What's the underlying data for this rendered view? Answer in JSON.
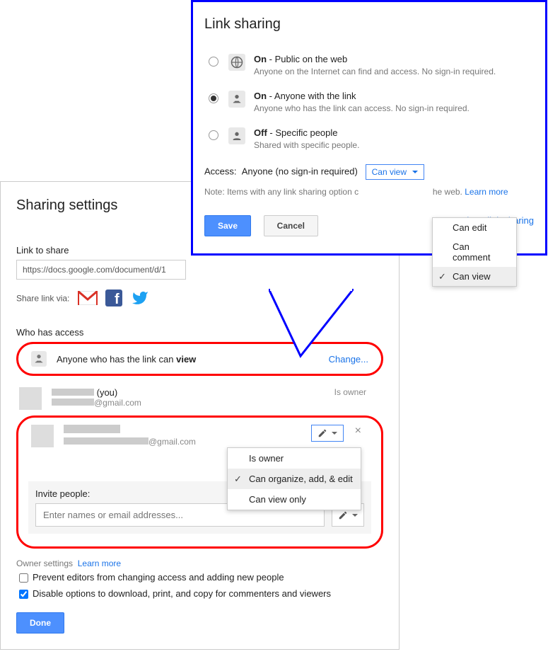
{
  "linkSharing": {
    "title": "Link sharing",
    "options": [
      {
        "bold": "On",
        "rest": " - Public on the web",
        "desc": "Anyone on the Internet can find and access. No sign-in required."
      },
      {
        "bold": "On",
        "rest": " - Anyone with the link",
        "desc": "Anyone who has the link can access. No sign-in required."
      },
      {
        "bold": "Off",
        "rest": " - Specific people",
        "desc": "Shared with specific people."
      }
    ],
    "accessLabel": "Access:",
    "accessWho": "Anyone (no sign-in required)",
    "accessDrop": "Can view",
    "noteA": "Note: Items with any link sharing option c",
    "noteB": "he web. ",
    "noteLearn": "Learn more",
    "save": "Save",
    "cancel": "Cancel",
    "learnLink": "e about link sharing",
    "menu": {
      "edit": "Can edit",
      "comment": "Can comment",
      "view": "Can view"
    }
  },
  "sharing": {
    "title": "Sharing settings",
    "linkLabel": "Link to share",
    "linkValue": "https://docs.google.com/document/d/1",
    "shareVia": "Share link via:",
    "whoLabel": "Who has access",
    "anyoneA": "Anyone who has the link can ",
    "anyoneB": "view",
    "change": "Change...",
    "you": " (you)",
    "gmail": "@gmail.com",
    "isOwner": "Is owner",
    "permMenu": {
      "owner": "Is owner",
      "organize": "Can organize, add, & edit",
      "viewonly": "Can view only"
    },
    "inviteLabel": "Invite people:",
    "invitePH": "Enter names or email addresses...",
    "ownerSettings": "Owner settings",
    "learnMore": "Learn more",
    "cb1": "Prevent editors from changing access and adding new people",
    "cb2": "Disable options to download, print, and copy for commenters and viewers",
    "done": "Done"
  }
}
